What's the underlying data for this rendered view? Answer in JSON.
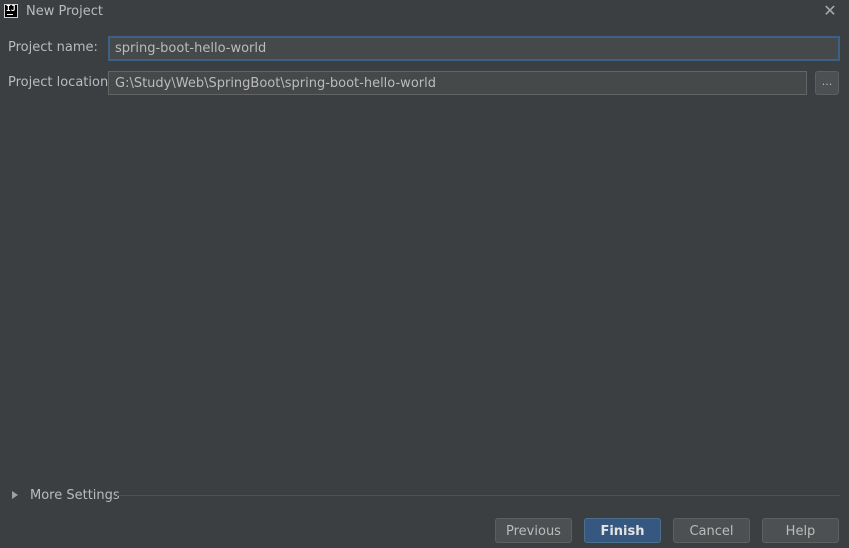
{
  "window": {
    "title": "New Project",
    "app_icon_text": "IJ"
  },
  "form": {
    "project_name_label": "Project name:",
    "project_name_value": "spring-boot-hello-world",
    "project_location_label": "Project location:",
    "project_location_value": "G:\\Study\\Web\\SpringBoot\\spring-boot-hello-world",
    "browse_label": "..."
  },
  "more_settings": {
    "label": "More Settings",
    "expanded": false
  },
  "buttons": {
    "previous": "Previous",
    "finish": "Finish",
    "cancel": "Cancel",
    "help": "Help"
  },
  "colors": {
    "background": "#3c3f41",
    "field_background": "#45494a",
    "focus_border": "#3d6185",
    "primary_button": "#365880",
    "text": "#bbbbbb"
  }
}
